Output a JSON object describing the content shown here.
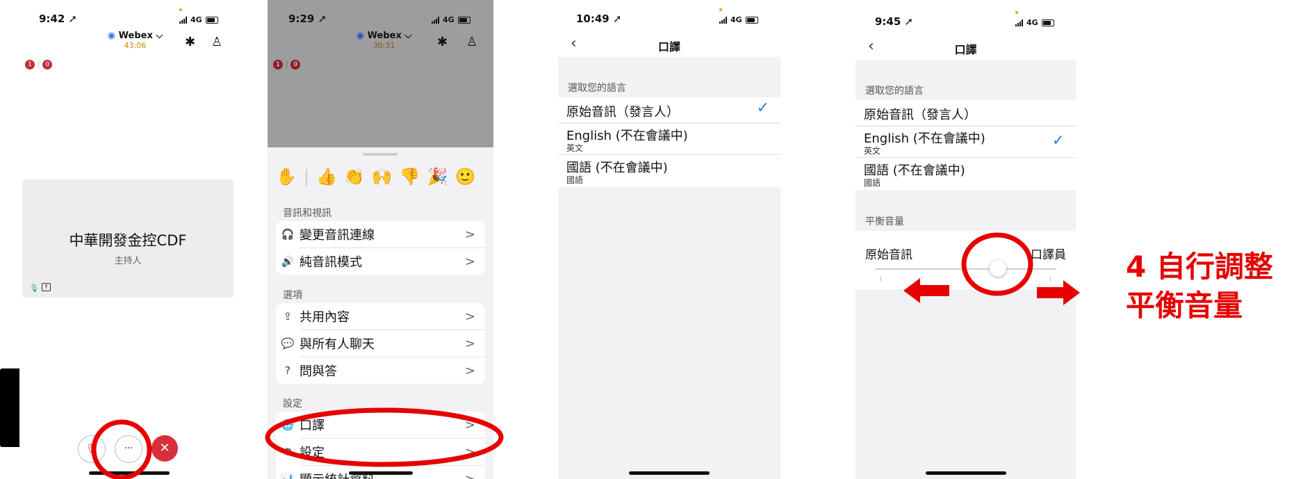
{
  "screens": [
    {
      "time": "9:42",
      "network": "4G",
      "app_name": "Webex",
      "meeting_timer": "43:06",
      "badges": [
        "1",
        "0"
      ],
      "participant": {
        "name": "中華開發金控CDF",
        "role": "主持人"
      },
      "controls": {
        "more_label": "···"
      }
    },
    {
      "time": "9:29",
      "network": "4G",
      "app_name": "Webex",
      "meeting_timer": "30:31",
      "badges": [
        "1",
        "0"
      ],
      "reactions": [
        "✋",
        "👍",
        "👏",
        "🙌",
        "👎",
        "🎉",
        "🙂"
      ],
      "sections": [
        {
          "title": "音訊和視訊",
          "items": [
            {
              "icon": "🎧",
              "label": "變更音訊連線"
            },
            {
              "icon": "🔊",
              "label": "純音訊模式"
            }
          ]
        },
        {
          "title": "選項",
          "items": [
            {
              "icon": "⇪",
              "label": "共用內容"
            },
            {
              "icon": "💬",
              "label": "與所有人聊天"
            },
            {
              "icon": "?",
              "label": "問與答"
            }
          ]
        },
        {
          "title": "設定",
          "items": [
            {
              "icon": "🌐",
              "label": "口譯"
            },
            {
              "icon": "⚙",
              "label": "設定"
            },
            {
              "icon": "📊",
              "label": "顯示統計資料"
            }
          ]
        }
      ]
    },
    {
      "time": "10:49",
      "network": "4G",
      "nav_title": "口譯",
      "section_label": "選取您的語言",
      "languages": [
        {
          "name": "原始音訊（發言人）",
          "sub": "",
          "selected": true
        },
        {
          "name": "English (不在會議中)",
          "sub": "英文",
          "selected": false
        },
        {
          "name": "國語 (不在會議中)",
          "sub": "國語",
          "selected": false
        }
      ]
    },
    {
      "time": "9:45",
      "network": "4G",
      "nav_title": "口譯",
      "section_label": "選取您的語言",
      "languages": [
        {
          "name": "原始音訊（發言人）",
          "sub": "",
          "selected": false
        },
        {
          "name": "English (不在會議中)",
          "sub": "英文",
          "selected": true
        },
        {
          "name": "國語 (不在會議中)",
          "sub": "國語",
          "selected": false
        }
      ],
      "balance_label": "平衡音量",
      "balance_left": "原始音訊",
      "balance_right": "口譯員",
      "balance_value": 0.68
    }
  ],
  "annotation": {
    "line1": "4 自行調整",
    "line2": "平衡音量",
    "color": "#e60000"
  },
  "colors": {
    "accent_blue": "#2a7de1",
    "annotation_red": "#e60000",
    "end_call_red": "#d8303a"
  }
}
